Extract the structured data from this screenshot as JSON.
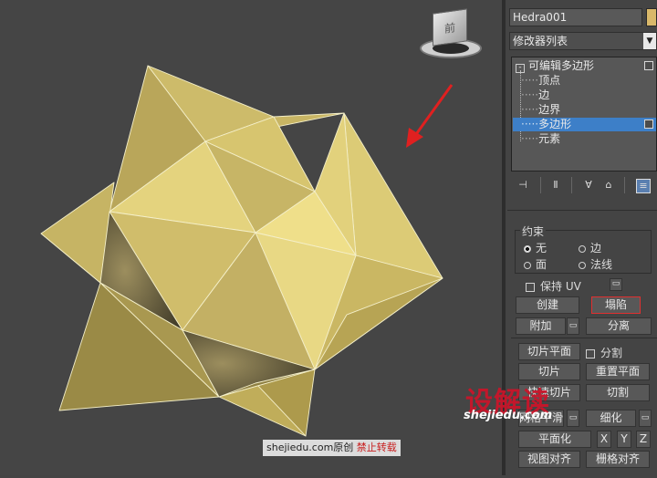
{
  "viewport": {
    "viewcube_face_label": "前",
    "arrow_color": "#e02020"
  },
  "watermark": {
    "site": "shejiedu.com",
    "original": "原创",
    "forbidden": "禁止转载",
    "brand": "设解读",
    "brand_url": "shejiedu.com"
  },
  "panel": {
    "object_name": "Hedra001",
    "modifier_list": "修改器列表",
    "modifier_stack": {
      "root": "可编辑多边形",
      "items": [
        "顶点",
        "边",
        "边界",
        "多边形",
        "元素"
      ],
      "selected": "多边形"
    },
    "constraints": {
      "title": "约束",
      "options": [
        "无",
        "边",
        "面",
        "法线"
      ],
      "selected": "无"
    },
    "preserve_uv": "保持 UV",
    "buttons": {
      "create": "创建",
      "collapse": "塌陷",
      "attach": "附加",
      "detach": "分离",
      "slice_plane": "切片平面",
      "split": "分割",
      "slice": "切片",
      "reset_plane": "重置平面",
      "quickslice": "快速切片",
      "cut": "切割",
      "meshsmooth": "网格平滑",
      "tessellate": "细化",
      "make_planar": "平面化",
      "x": "X",
      "y": "Y",
      "z": "Z",
      "view_align": "视图对齐",
      "grid_align": "栅格对齐"
    },
    "highlight_color": "#e03030",
    "selection_color": "#3d7fc8",
    "object_color": "#d9b86a"
  }
}
